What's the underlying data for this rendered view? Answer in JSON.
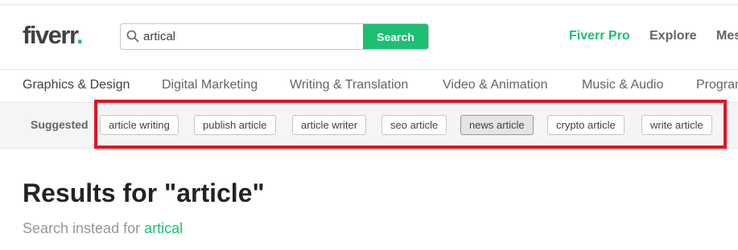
{
  "header": {
    "logo_text": "fiverr",
    "logo_dot": ".",
    "search": {
      "value": "artical",
      "placeholder": "",
      "button_label": "Search"
    },
    "links": [
      "Fiverr Pro",
      "Explore",
      "Mes"
    ]
  },
  "categories": [
    "Graphics & Design",
    "Digital Marketing",
    "Writing & Translation",
    "Video & Animation",
    "Music & Audio",
    "Program"
  ],
  "suggested": {
    "label": "Suggested",
    "chips": [
      "article writing",
      "publish article",
      "article writer",
      "seo article",
      "news article",
      "crypto article",
      "write article"
    ],
    "active_chip": "news article"
  },
  "results": {
    "title": "Results for \"article\"",
    "instead_prefix": "Search instead for ",
    "instead_link": "artical"
  },
  "colors": {
    "brand_green": "#1dbf73",
    "highlight_red": "#e0141e",
    "text_dark": "#404145",
    "text_muted": "#62646a"
  }
}
